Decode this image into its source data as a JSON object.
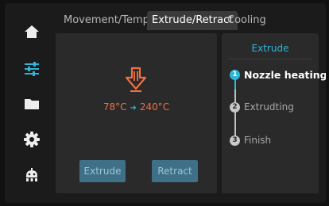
{
  "sidebar": {
    "items": [
      {
        "icon": "home-icon",
        "active": false
      },
      {
        "icon": "sliders-icon",
        "active": true
      },
      {
        "icon": "folder-icon",
        "active": false
      },
      {
        "icon": "gear-icon",
        "active": false
      },
      {
        "icon": "robot-icon",
        "active": false
      }
    ]
  },
  "tabs": [
    {
      "label": "Movement/Temp.",
      "active": false
    },
    {
      "label": "Extrude/Retract",
      "active": true
    },
    {
      "label": "Cooling",
      "active": false
    }
  ],
  "extrude_panel": {
    "current_temp": "78°C",
    "target_temp": "240°C",
    "extrude_label": "Extrude",
    "retract_label": "Retract"
  },
  "steps_panel": {
    "title": "Extrude",
    "steps": [
      {
        "num": "1",
        "label": "Nozzle heating",
        "active": true
      },
      {
        "num": "2",
        "label": "Extrudting",
        "active": false
      },
      {
        "num": "3",
        "label": "Finish",
        "active": false
      }
    ]
  },
  "colors": {
    "accent": "#2fb6d8",
    "temp": "#f07040",
    "button_bg": "#3e7088"
  }
}
